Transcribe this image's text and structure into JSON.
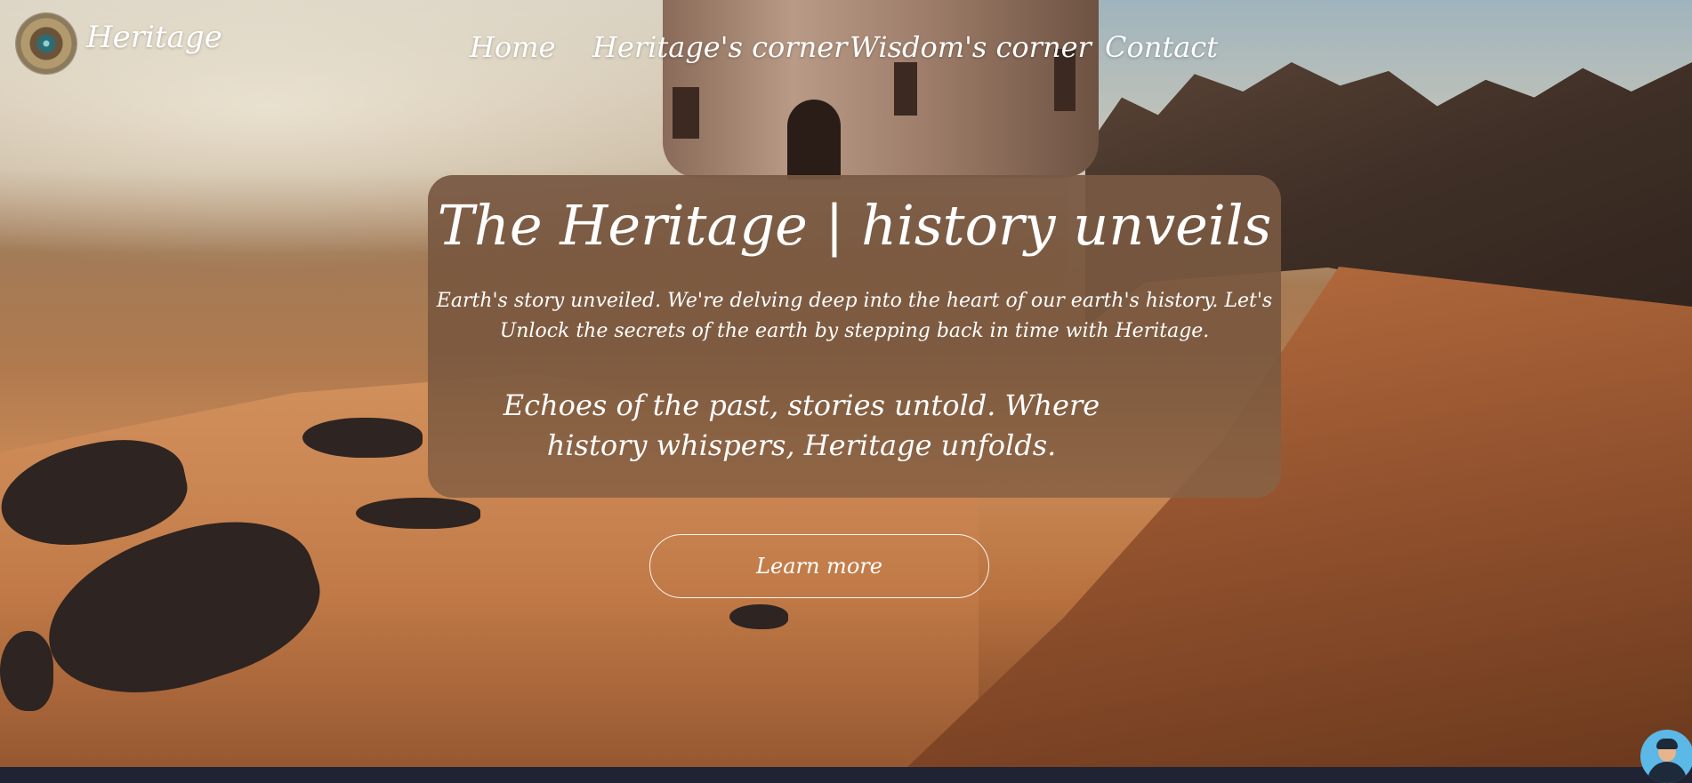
{
  "site": {
    "brand": "Heritage"
  },
  "nav": {
    "items": [
      {
        "label": "Home"
      },
      {
        "label": "Heritage's corner"
      },
      {
        "label": "Wisdom's corner"
      },
      {
        "label": "Contact"
      }
    ]
  },
  "hero": {
    "title": "The Heritage | history unveils",
    "description": "Earth's story unveiled. We're delving deep into the heart of our earth's history. Let's Unlock the secrets of the earth by stepping back in time with Heritage.",
    "tagline": "Echoes of the past, stories untold. Where history whispers, Heritage unfolds.",
    "cta_label": "Learn more"
  },
  "icons": {
    "logo": "compass-emblem-icon",
    "avatar": "user-avatar-icon"
  },
  "colors": {
    "card_background": "#7a5840",
    "text": "#ffffff",
    "avatar_background": "#5cb8e6"
  }
}
